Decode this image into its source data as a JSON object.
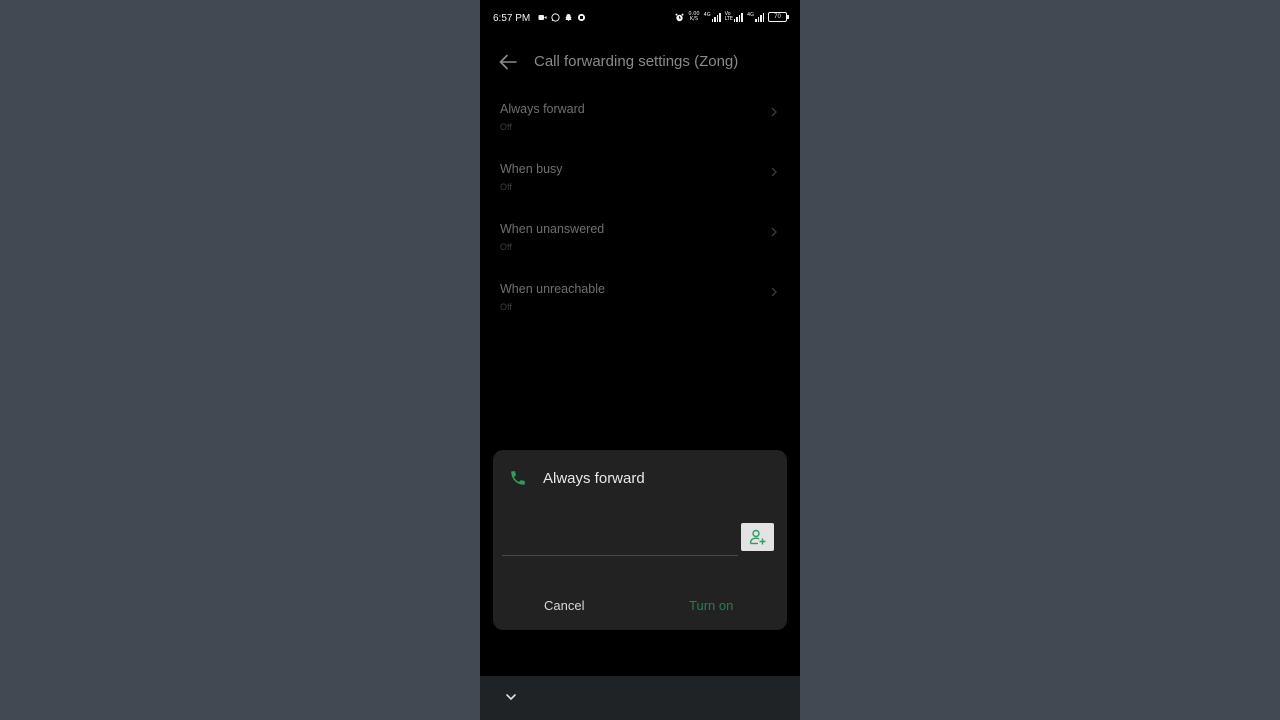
{
  "status_bar": {
    "time": "6:57 PM",
    "speed_value": "0.00",
    "speed_unit": "K/S",
    "sim1": "4G",
    "sim2_top": "Vo",
    "sim2_bottom": "LTE",
    "sim3": "4G",
    "battery": "70"
  },
  "header": {
    "title": "Call forwarding settings (Zong)"
  },
  "forward_options": [
    {
      "title": "Always forward",
      "status": "Off"
    },
    {
      "title": "When busy",
      "status": "Off"
    },
    {
      "title": "When unanswered",
      "status": "Off"
    },
    {
      "title": "When unreachable",
      "status": "Off"
    }
  ],
  "dialog": {
    "title": "Always forward",
    "input_value": "",
    "input_placeholder": "",
    "cancel_label": "Cancel",
    "confirm_label": "Turn on",
    "accent_color": "#2f9e5c"
  }
}
